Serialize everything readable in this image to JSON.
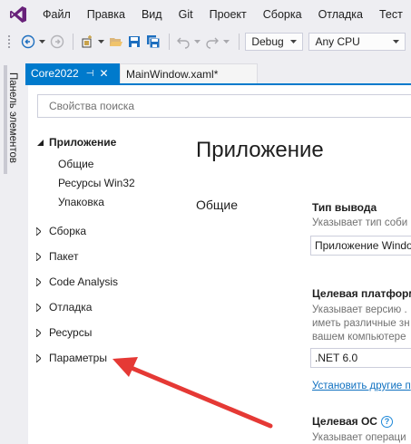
{
  "menu": {
    "items": [
      "Файл",
      "Правка",
      "Вид",
      "Git",
      "Проект",
      "Сборка",
      "Отладка",
      "Тест"
    ]
  },
  "toolbar": {
    "configuration": "Debug",
    "platform": "Any CPU"
  },
  "sidebar": {
    "toolbox_label": "Панель элементов"
  },
  "tabs": [
    {
      "label": "Core2022",
      "active": true
    },
    {
      "label": "MainWindow.xaml*",
      "active": false
    }
  ],
  "search": {
    "placeholder": "Свойства поиска"
  },
  "nav": {
    "groups": [
      {
        "label": "Приложение",
        "expanded": true,
        "children": [
          "Общие",
          "Ресурсы Win32",
          "Упаковка"
        ]
      },
      {
        "label": "Сборка",
        "expanded": false
      },
      {
        "label": "Пакет",
        "expanded": false
      },
      {
        "label": "Code Analysis",
        "expanded": false
      },
      {
        "label": "Отладка",
        "expanded": false
      },
      {
        "label": "Ресурсы",
        "expanded": false
      },
      {
        "label": "Параметры",
        "expanded": false
      }
    ]
  },
  "main": {
    "title": "Приложение",
    "section": "Общие",
    "output_type": {
      "title": "Тип вывода",
      "description": "Указывает тип соби",
      "value": "Приложение Windo"
    },
    "target_platform": {
      "title": "Целевая платформ",
      "description_lines": [
        "Указывает версию .",
        "иметь различные зн",
        "вашем компьютере"
      ],
      "value": ".NET 6.0",
      "link": "Установить другие п"
    },
    "target_os": {
      "title": "Целевая ОС",
      "help": "?",
      "description": "Указывает операци"
    }
  },
  "colors": {
    "accent": "#007acc",
    "annotation_arrow": "#e53935",
    "vs_logo": "#68217a"
  }
}
